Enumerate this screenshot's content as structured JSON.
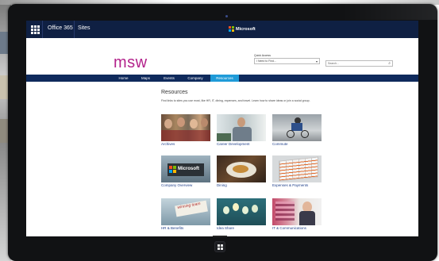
{
  "suitebar": {
    "app_name": "Office 365",
    "section": "Sites",
    "brand": "Microsoft"
  },
  "site": {
    "logo_text": "msw",
    "quick_access_label": "Quick Access",
    "quick_access_value": "I Need to Find...",
    "search_placeholder": "Search..."
  },
  "nav": {
    "items": [
      {
        "label": "Home",
        "active": false
      },
      {
        "label": "Maps",
        "active": false
      },
      {
        "label": "Events",
        "active": false
      },
      {
        "label": "Company",
        "active": false
      },
      {
        "label": "Resources",
        "active": true
      }
    ]
  },
  "resources": {
    "title": "Resources",
    "description": "Find links to sites you use most, like HR, IT, dining, expenses, and travel. Learn how to share ideas or join a social group.",
    "tiles": [
      {
        "label": "Archives",
        "icon": "people-photo"
      },
      {
        "label": "Career Development",
        "icon": "man-office-photo"
      },
      {
        "label": "Commute",
        "icon": "cyclist-photo"
      },
      {
        "label": "Company Overview",
        "icon": "microsoft-sign-photo"
      },
      {
        "label": "Dining",
        "icon": "food-photo"
      },
      {
        "label": "Expenses & Payments",
        "icon": "spreadsheet-photo"
      },
      {
        "label": "HR & Benefits",
        "icon": "winning-team-photo"
      },
      {
        "label": "Idea Share",
        "icon": "lightbulbs-photo"
      },
      {
        "label": "IT & Communications",
        "icon": "woman-headset-photo"
      }
    ]
  },
  "colors": {
    "suitebar_bg": "#0f2043",
    "nav_bg": "#0f2a5c",
    "nav_active": "#1f9bd8",
    "brand_magenta": "#b3228b",
    "link_blue": "#1f3f8a"
  }
}
